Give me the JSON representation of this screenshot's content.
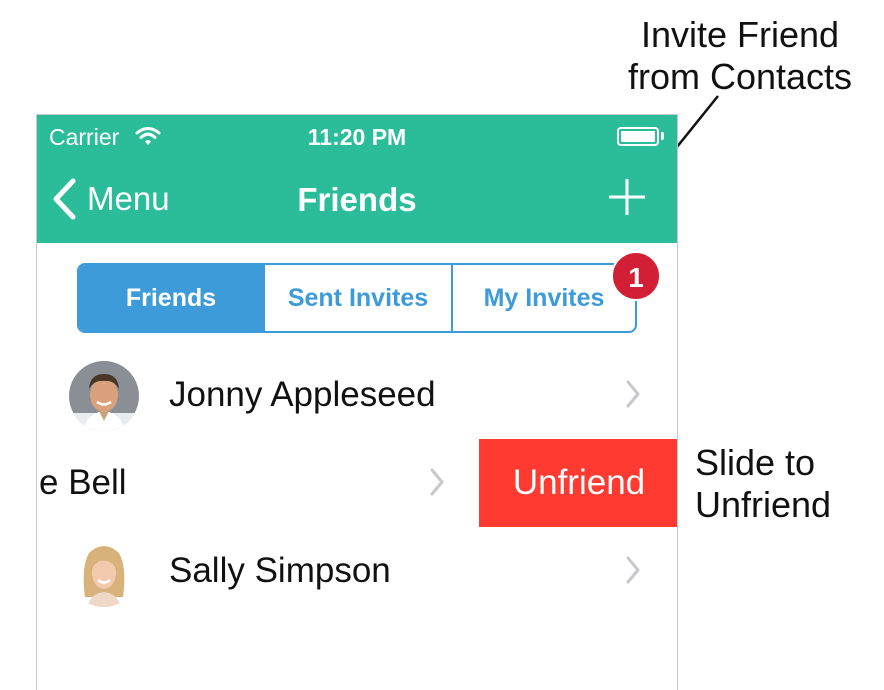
{
  "annotations": {
    "invite_line1": "Invite Friend",
    "invite_line2": "from Contacts",
    "slide_line1": "Slide to",
    "slide_line2": "Unfriend"
  },
  "status_bar": {
    "carrier": "Carrier",
    "time": "11:20 PM",
    "wifi_icon": "wifi-icon",
    "battery_icon": "battery-icon"
  },
  "nav": {
    "back_label": "Menu",
    "title": "Friends",
    "add_icon": "plus-icon"
  },
  "segments": {
    "friends": "Friends",
    "sent": "Sent Invites",
    "my": "My Invites",
    "badge": "1",
    "selected": "Friends"
  },
  "friends": [
    {
      "name": "Jonny Appleseed"
    },
    {
      "name": "e Bell"
    },
    {
      "name": "Sally Simpson"
    }
  ],
  "swipe_action": {
    "label": "Unfriend"
  },
  "colors": {
    "header": "#2bbd9a",
    "segment_accent": "#3d9bd9",
    "badge": "#d21f35",
    "unfriend": "#ff3a30"
  }
}
